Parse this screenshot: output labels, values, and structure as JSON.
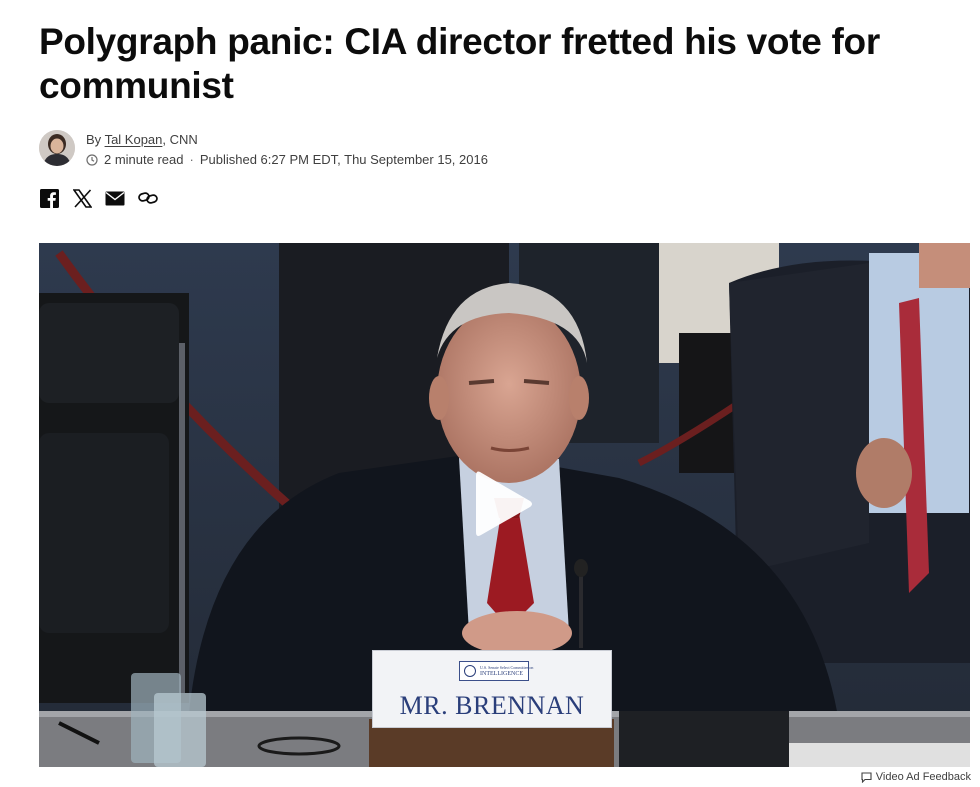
{
  "article": {
    "headline": "Polygraph panic: CIA director fretted his vote for communist",
    "byline_prefix": "By ",
    "author": "Tal Kopan",
    "outlet_suffix": ", CNN",
    "read_time": "2 minute read",
    "published": "Published 6:27 PM EDT, Thu September 15, 2016"
  },
  "share": {
    "icons": [
      "facebook-icon",
      "x-icon",
      "email-icon",
      "link-icon"
    ]
  },
  "video": {
    "nameplate_seal_text_1": "U.S. Senate Select Committee on",
    "nameplate_seal_text_2": "INTELLIGENCE",
    "nameplate_name": "MR. BRENNAN",
    "play_icon": "play-icon"
  },
  "ad_feedback": {
    "label": "Video Ad Feedback",
    "icon": "comment-icon"
  }
}
